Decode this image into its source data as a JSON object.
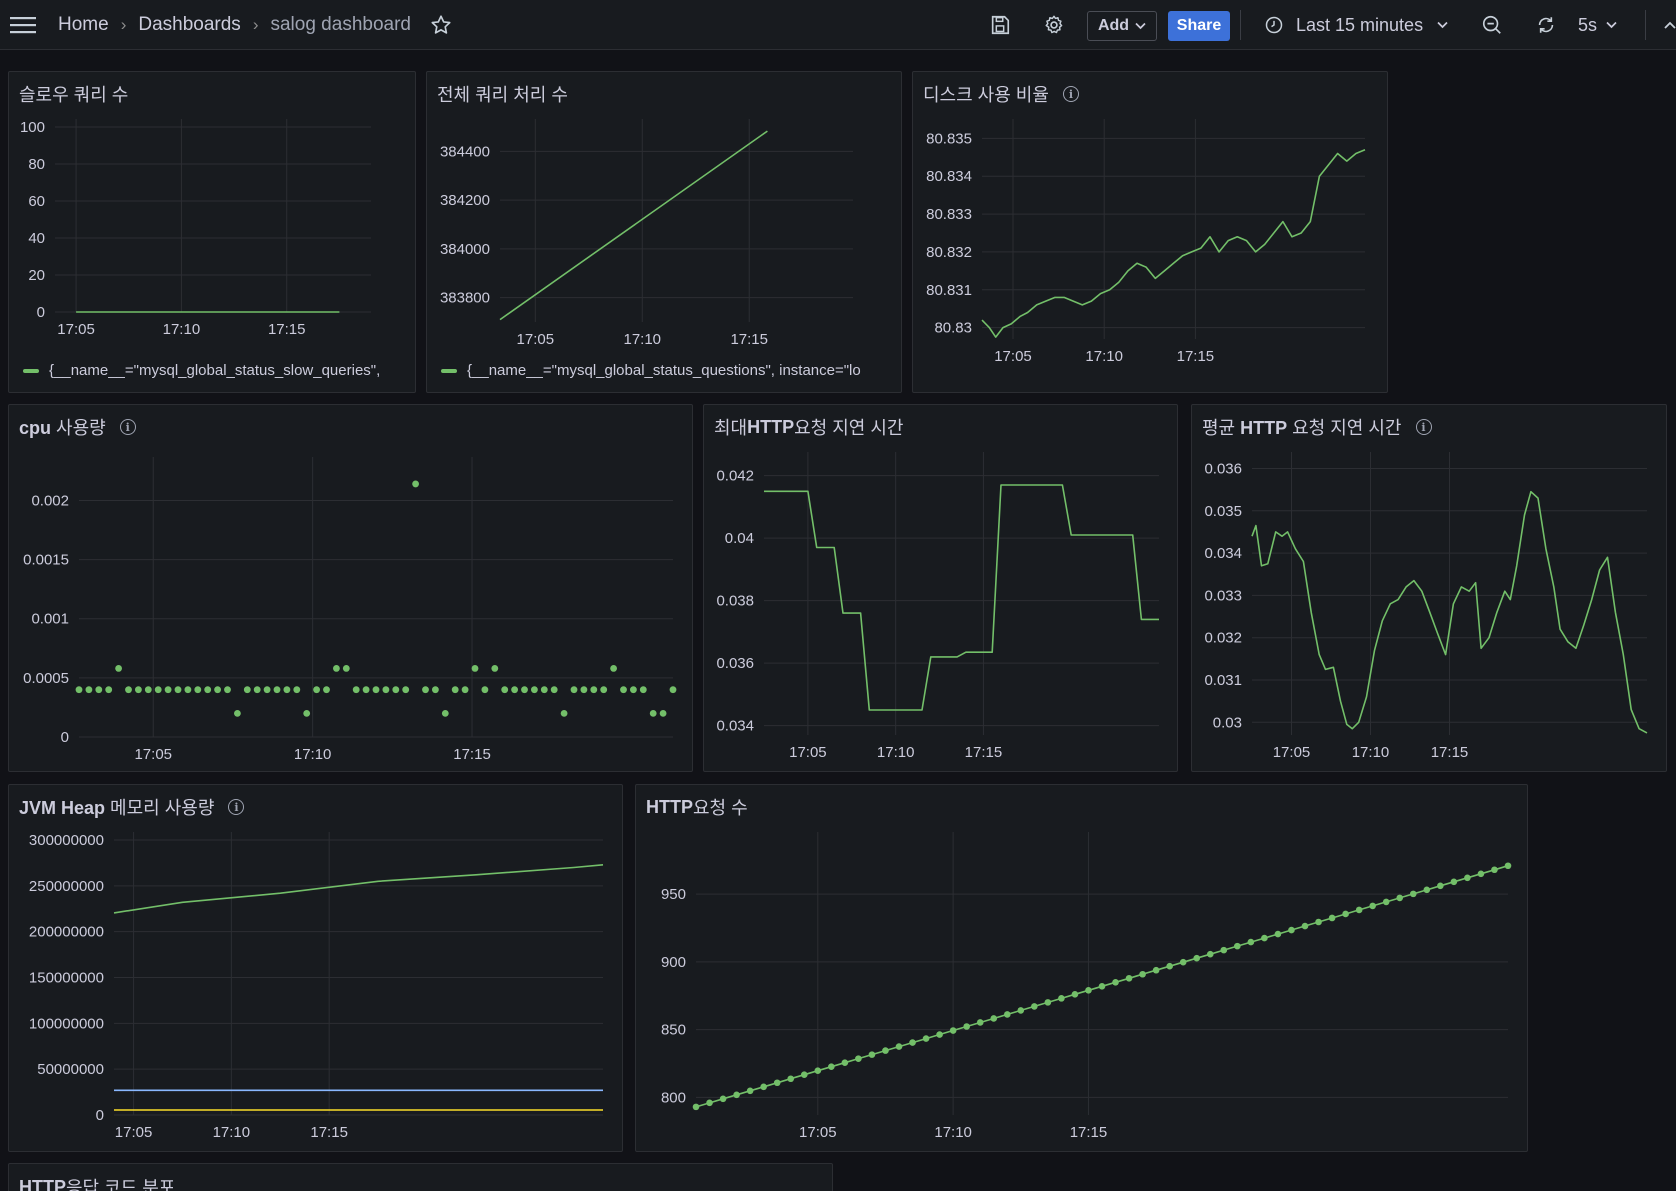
{
  "topbar": {
    "breadcrumbs": [
      "Home",
      "Dashboards",
      "salog dashboard"
    ],
    "separator": "›",
    "add_label": "Add",
    "share_label": "Share",
    "time_range": "Last 15 minutes",
    "refresh_interval": "5s",
    "icons": [
      "menu-icon",
      "star-icon",
      "save-icon",
      "gear-icon",
      "clock-icon",
      "zoom-out-icon",
      "refresh-icon"
    ]
  },
  "panels": {
    "slow_queries": {
      "title": "슬로우 쿼리 수",
      "legend": "{__name__=\"mysql_global_status_slow_queries\","
    },
    "total_queries": {
      "title": "전체 쿼리 처리 수",
      "legend": "{__name__=\"mysql_global_status_questions\", instance=\"lo"
    },
    "disk_usage": {
      "title": "디스크 사용 비율"
    },
    "cpu": {
      "title": "cpu 사용량"
    },
    "max_http": {
      "title": "최대 HTTP 요청 지연 시간"
    },
    "avg_http": {
      "title": "평균 HTTP 요청 지연 시간"
    },
    "jvm_heap": {
      "title": "JVM Heap 메모리 사용량"
    },
    "http_requests": {
      "title": "HTTP 요청 수"
    },
    "http_codes": {
      "title": "HTTP 응답 코드 분포"
    }
  },
  "colors": {
    "green": "#73bf69",
    "blue": "#8ab8ff",
    "yellow": "#fade2a",
    "grid": "#2c2e33",
    "bg": "#181b1f"
  },
  "chart_data": [
    {
      "id": "slow_queries",
      "type": "line",
      "x_ticks": [
        "17:05",
        "17:10",
        "17:15"
      ],
      "y_ticks": [
        0,
        20,
        40,
        60,
        80,
        100
      ],
      "ylim": [
        0,
        100
      ],
      "series": [
        {
          "name": "{__name__=\"mysql_global_status_slow_queries\",",
          "color": "#73bf69",
          "values": [
            [
              17.05,
              0
            ],
            [
              17.3,
              0
            ]
          ]
        }
      ]
    },
    {
      "id": "total_queries",
      "type": "line",
      "x_ticks": [
        "17:05",
        "17:10",
        "17:15"
      ],
      "y_ticks": [
        383800,
        384000,
        384200,
        384400
      ],
      "ylim": [
        383700,
        384500
      ],
      "series": [
        {
          "name": "{__name__=\"mysql_global_status_questions\", instance=\"lo",
          "color": "#73bf69",
          "values": [
            [
              17.05,
              383710
            ],
            [
              17.3,
              384483
            ]
          ]
        }
      ]
    },
    {
      "id": "disk_usage",
      "type": "line",
      "x_ticks": [
        "17:05",
        "17:10",
        "17:15"
      ],
      "y_ticks": [
        "80.83",
        "80.831",
        "80.832",
        "80.833",
        "80.834",
        "80.835"
      ],
      "ylim": [
        80.8297,
        80.8353
      ],
      "series": [
        {
          "color": "#73bf69",
          "values": [
            [
              17.03,
              80.8302
            ],
            [
              17.038,
              80.83
            ],
            [
              17.045,
              80.82975
            ],
            [
              17.053,
              80.83
            ],
            [
              17.062,
              80.8301
            ],
            [
              17.072,
              80.8303
            ],
            [
              17.08,
              80.8304
            ],
            [
              17.09,
              80.8306
            ],
            [
              17.1,
              80.8307
            ],
            [
              17.11,
              80.8308
            ],
            [
              17.12,
              80.8308
            ],
            [
              17.13,
              80.8307
            ],
            [
              17.14,
              80.8306
            ],
            [
              17.15,
              80.8307
            ],
            [
              17.16,
              80.8309
            ],
            [
              17.17,
              80.831
            ],
            [
              17.18,
              80.8312
            ],
            [
              17.19,
              80.8315
            ],
            [
              17.2,
              80.8317
            ],
            [
              17.21,
              80.8316
            ],
            [
              17.22,
              80.8313
            ],
            [
              17.23,
              80.8315
            ],
            [
              17.24,
              80.8317
            ],
            [
              17.25,
              80.8319
            ],
            [
              17.26,
              80.832
            ],
            [
              17.27,
              80.8321
            ],
            [
              17.28,
              80.8324
            ],
            [
              17.29,
              80.832
            ],
            [
              17.3,
              80.8323
            ],
            [
              17.31,
              80.8324
            ],
            [
              17.32,
              80.8323
            ],
            [
              17.33,
              80.832
            ],
            [
              17.34,
              80.8322
            ],
            [
              17.35,
              80.8325
            ],
            [
              17.36,
              80.8328
            ],
            [
              17.37,
              80.8324
            ],
            [
              17.38,
              80.8325
            ],
            [
              17.39,
              80.8328
            ],
            [
              17.4,
              80.834
            ],
            [
              17.41,
              80.8343
            ],
            [
              17.42,
              80.8346
            ],
            [
              17.43,
              80.8344
            ],
            [
              17.44,
              80.8346
            ],
            [
              17.45,
              80.8347
            ]
          ]
        }
      ]
    },
    {
      "id": "cpu",
      "type": "scatter",
      "x_ticks": [
        "17:05",
        "17:10",
        "17:15"
      ],
      "y_ticks": [
        "0",
        "0.0005",
        "0.001",
        "0.0015",
        "0.002"
      ],
      "ylim": [
        0,
        0.0023
      ],
      "series": [
        {
          "color": "#73bf69",
          "values": [
            [
              0.0004,
              0
            ],
            [
              0.0004,
              1
            ],
            [
              0.0004,
              2
            ],
            [
              0.0004,
              3
            ],
            [
              0.00058,
              4
            ],
            [
              0.0004,
              5
            ],
            [
              0.0004,
              6
            ],
            [
              0.0004,
              7
            ],
            [
              0.0004,
              8
            ],
            [
              0.0004,
              9
            ],
            [
              0.0004,
              10
            ],
            [
              0.0004,
              11
            ],
            [
              0.0004,
              12
            ],
            [
              0.0004,
              13
            ],
            [
              0.0004,
              14
            ],
            [
              0.0004,
              15
            ],
            [
              0.0002,
              16
            ],
            [
              0.0004,
              17
            ],
            [
              0.0004,
              18
            ],
            [
              0.0004,
              19
            ],
            [
              0.0004,
              20
            ],
            [
              0.0004,
              21
            ],
            [
              0.0004,
              22
            ],
            [
              0.0002,
              23
            ],
            [
              0.0004,
              24
            ],
            [
              0.0004,
              25
            ],
            [
              0.00058,
              26
            ],
            [
              0.00058,
              27
            ],
            [
              0.0004,
              28
            ],
            [
              0.0004,
              29
            ],
            [
              0.0004,
              30
            ],
            [
              0.0004,
              31
            ],
            [
              0.0004,
              32
            ],
            [
              0.0004,
              33
            ],
            [
              0.00214,
              34
            ],
            [
              0.0004,
              35
            ],
            [
              0.0004,
              36
            ],
            [
              0.0002,
              37
            ],
            [
              0.0004,
              38
            ],
            [
              0.0004,
              39
            ],
            [
              0.00058,
              40
            ],
            [
              0.0004,
              41
            ],
            [
              0.00058,
              42
            ],
            [
              0.0004,
              43
            ],
            [
              0.0004,
              44
            ],
            [
              0.0004,
              45
            ],
            [
              0.0004,
              46
            ],
            [
              0.0004,
              47
            ],
            [
              0.0004,
              48
            ],
            [
              0.0002,
              49
            ],
            [
              0.0004,
              50
            ],
            [
              0.0004,
              51
            ],
            [
              0.0004,
              52
            ],
            [
              0.0004,
              53
            ],
            [
              0.00058,
              54
            ],
            [
              0.0004,
              55
            ],
            [
              0.0004,
              56
            ],
            [
              0.0004,
              57
            ],
            [
              0.0002,
              58
            ],
            [
              0.0002,
              59
            ],
            [
              0.0004,
              60
            ]
          ]
        }
      ]
    },
    {
      "id": "max_http",
      "type": "line",
      "x_ticks": [
        "17:05",
        "17:10",
        "17:15"
      ],
      "y_ticks": [
        "0.034",
        "0.036",
        "0.038",
        "0.04",
        "0.042"
      ],
      "ylim": [
        0.0337,
        0.0425
      ],
      "series": [
        {
          "color": "#73bf69",
          "values": [
            [
              17.0,
              0.0415
            ],
            [
              17.05,
              0.0415
            ],
            [
              17.06,
              0.0397
            ],
            [
              17.08,
              0.0397
            ],
            [
              17.09,
              0.0376
            ],
            [
              17.11,
              0.0376
            ],
            [
              17.12,
              0.0345
            ],
            [
              17.18,
              0.0345
            ],
            [
              17.19,
              0.0362
            ],
            [
              17.22,
              0.0362
            ],
            [
              17.23,
              0.03635
            ],
            [
              17.26,
              0.03635
            ],
            [
              17.27,
              0.0417
            ],
            [
              17.34,
              0.0417
            ],
            [
              17.35,
              0.0401
            ],
            [
              17.42,
              0.0401
            ],
            [
              17.43,
              0.0374
            ],
            [
              17.45,
              0.0374
            ]
          ]
        }
      ]
    },
    {
      "id": "avg_http",
      "type": "line",
      "x_ticks": [
        "17:05",
        "17:10",
        "17:15"
      ],
      "y_ticks": [
        "0.03",
        "0.031",
        "0.032",
        "0.033",
        "0.034",
        "0.035",
        "0.036"
      ],
      "ylim": [
        0.0297,
        0.0362
      ],
      "series": [
        {
          "color": "#73bf69",
          "values": [
            [
              17.0,
              0.0344
            ],
            [
              17.005,
              0.03465
            ],
            [
              17.012,
              0.0337
            ],
            [
              17.02,
              0.03375
            ],
            [
              17.03,
              0.0345
            ],
            [
              17.038,
              0.0344
            ],
            [
              17.045,
              0.0345
            ],
            [
              17.055,
              0.0341
            ],
            [
              17.065,
              0.0338
            ],
            [
              17.075,
              0.0326
            ],
            [
              17.085,
              0.0316
            ],
            [
              17.093,
              0.03125
            ],
            [
              17.103,
              0.0313
            ],
            [
              17.112,
              0.0305
            ],
            [
              17.12,
              0.02995
            ],
            [
              17.127,
              0.02985
            ],
            [
              17.135,
              0.03
            ],
            [
              17.145,
              0.0306
            ],
            [
              17.155,
              0.0317
            ],
            [
              17.165,
              0.0324
            ],
            [
              17.175,
              0.0328
            ],
            [
              17.185,
              0.0329
            ],
            [
              17.195,
              0.0332
            ],
            [
              17.205,
              0.03335
            ],
            [
              17.215,
              0.0331
            ],
            [
              17.225,
              0.0326
            ],
            [
              17.235,
              0.0321
            ],
            [
              17.245,
              0.0316
            ],
            [
              17.255,
              0.0328
            ],
            [
              17.265,
              0.0332
            ],
            [
              17.275,
              0.0331
            ],
            [
              17.283,
              0.0333
            ],
            [
              17.29,
              0.03175
            ],
            [
              17.3,
              0.032
            ],
            [
              17.31,
              0.0326
            ],
            [
              17.32,
              0.0331
            ],
            [
              17.327,
              0.0329
            ],
            [
              17.335,
              0.0337
            ],
            [
              17.345,
              0.0349
            ],
            [
              17.353,
              0.03545
            ],
            [
              17.362,
              0.0353
            ],
            [
              17.372,
              0.0341
            ],
            [
              17.382,
              0.0332
            ],
            [
              17.39,
              0.0322
            ],
            [
              17.4,
              0.0319
            ],
            [
              17.41,
              0.03175
            ],
            [
              17.42,
              0.0323
            ],
            [
              17.43,
              0.0329
            ],
            [
              17.44,
              0.0336
            ],
            [
              17.45,
              0.0339
            ],
            [
              17.46,
              0.0326
            ],
            [
              17.47,
              0.0316
            ],
            [
              17.48,
              0.0303
            ],
            [
              17.49,
              0.02985
            ],
            [
              17.5,
              0.02975
            ]
          ]
        }
      ]
    },
    {
      "id": "jvm_heap",
      "type": "line",
      "x_ticks": [
        "17:05",
        "17:10",
        "17:15"
      ],
      "y_ticks": [
        "0",
        "50000000",
        "100000000",
        "150000000",
        "200000000",
        "250000000",
        "300000000"
      ],
      "ylim": [
        0,
        300000000
      ],
      "series": [
        {
          "color": "#73bf69",
          "values": [
            [
              17.03,
              220500000
            ],
            [
              17.1,
              232000000
            ],
            [
              17.2,
              242000000
            ],
            [
              17.3,
              255000000
            ],
            [
              17.4,
              262000000
            ],
            [
              17.5,
              270000000
            ],
            [
              17.53,
              273000000
            ]
          ]
        },
        {
          "color": "#8ab8ff",
          "values": [
            [
              17.03,
              27000000
            ],
            [
              17.53,
              27000000
            ]
          ]
        },
        {
          "color": "#fade2a",
          "values": [
            [
              17.03,
              5500000
            ],
            [
              17.53,
              5500000
            ]
          ]
        }
      ]
    },
    {
      "id": "http_requests",
      "type": "line",
      "x_ticks": [
        "17:05",
        "17:10",
        "17:15"
      ],
      "y_ticks": [
        800,
        850,
        900,
        950
      ],
      "ylim": [
        787,
        990
      ],
      "series": [
        {
          "color": "#73bf69",
          "points": true,
          "values": [
            [
              17.0,
              793
            ],
            [
              17.6,
              971
            ]
          ]
        }
      ]
    }
  ]
}
